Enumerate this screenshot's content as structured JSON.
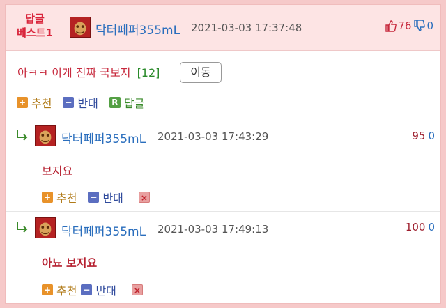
{
  "best": {
    "badge_line1": "답글",
    "badge_line2": "베스트1",
    "nickname": "닥터페퍼355mL",
    "timestamp": "2021-03-03 17:37:48",
    "up_count": "76",
    "down_count": "0"
  },
  "post": {
    "title": "아ㅋㅋ 이게 진짜 국보지",
    "comment_count": "[12]",
    "move_label": "이동"
  },
  "actions": {
    "recommend_label": "추천",
    "oppose_label": "반대",
    "reply_label": "답글",
    "reply_box": "R"
  },
  "comments": [
    {
      "nickname": "닥터페퍼355mL",
      "timestamp": "2021-03-03 17:43:29",
      "body": "보지요",
      "up": "95",
      "down": "0"
    },
    {
      "nickname": "닥터페퍼355mL",
      "timestamp": "2021-03-03 17:49:13",
      "body": "아뇨 보지요",
      "up": "100",
      "down": "0"
    }
  ],
  "colors": {
    "background": "#f6c9c9",
    "header": "#fde4e4",
    "accent_red": "#c7293d",
    "nick_blue": "#2a6ebd"
  }
}
